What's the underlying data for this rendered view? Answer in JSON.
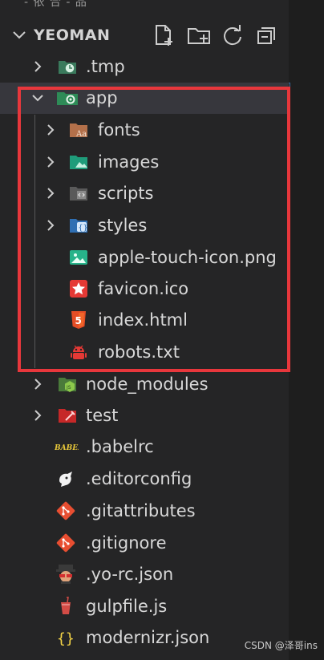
{
  "top_strip": {
    "text": "- 依 合 - 品"
  },
  "section": {
    "title": "YEOMAN"
  },
  "actions": [
    {
      "name": "new-file-icon"
    },
    {
      "name": "new-folder-icon"
    },
    {
      "name": "refresh-icon"
    },
    {
      "name": "collapse-all-icon"
    }
  ],
  "tree": [
    {
      "label": ".tmp",
      "type": "folder",
      "expanded": false,
      "icon": "tmp-folder-icon"
    },
    {
      "label": "app",
      "type": "folder",
      "expanded": true,
      "icon": "app-folder-icon",
      "selected": true
    },
    {
      "label": "fonts",
      "type": "folder",
      "expanded": false,
      "icon": "fonts-folder-icon"
    },
    {
      "label": "images",
      "type": "folder",
      "expanded": false,
      "icon": "images-folder-icon"
    },
    {
      "label": "scripts",
      "type": "folder",
      "expanded": false,
      "icon": "scripts-folder-icon"
    },
    {
      "label": "styles",
      "type": "folder",
      "expanded": false,
      "icon": "styles-folder-icon"
    },
    {
      "label": "apple-touch-icon.png",
      "type": "file",
      "icon": "image-file-icon"
    },
    {
      "label": "favicon.ico",
      "type": "file",
      "icon": "favicon-file-icon"
    },
    {
      "label": "index.html",
      "type": "file",
      "icon": "html5-file-icon"
    },
    {
      "label": "robots.txt",
      "type": "file",
      "icon": "robot-file-icon"
    },
    {
      "label": "node_modules",
      "type": "folder",
      "expanded": false,
      "icon": "node-modules-folder-icon"
    },
    {
      "label": "test",
      "type": "folder",
      "expanded": false,
      "icon": "test-folder-icon"
    },
    {
      "label": ".babelrc",
      "type": "file",
      "icon": "babel-file-icon"
    },
    {
      "label": ".editorconfig",
      "type": "file",
      "icon": "editorconfig-file-icon"
    },
    {
      "label": ".gitattributes",
      "type": "file",
      "icon": "git-file-icon"
    },
    {
      "label": ".gitignore",
      "type": "file",
      "icon": "git-file-icon"
    },
    {
      "label": ".yo-rc.json",
      "type": "file",
      "icon": "yeoman-file-icon"
    },
    {
      "label": "gulpfile.js",
      "type": "file",
      "icon": "gulp-file-icon"
    },
    {
      "label": "modernizr.json",
      "type": "file",
      "icon": "json-file-icon"
    }
  ],
  "watermark": "CSDN @泽哥ins",
  "colors": {
    "highlight": "#e8373c",
    "background": "#252526",
    "selected": "#37373d"
  }
}
